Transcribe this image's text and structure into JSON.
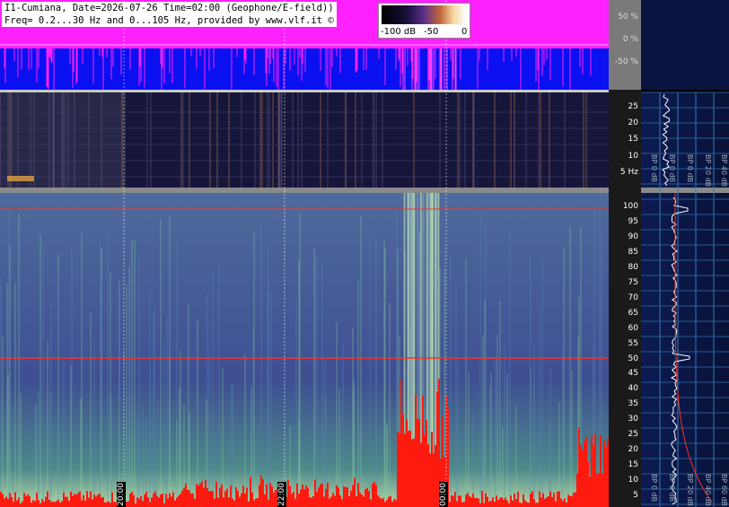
{
  "header": {
    "line1": "I1-Cumiana, Date=2026-07-26 Time=02:00 (Geophone/E-field))",
    "line2": "Freq= 0.2...30 Hz and 0...105 Hz, provided by www.vlf.it ©"
  },
  "legend": {
    "label_min": "-100 dB",
    "label_mid": "-50",
    "label_max": "0"
  },
  "amplitude_axis": {
    "ticks": [
      "50 %",
      "0 %",
      "-50 %"
    ]
  },
  "low_band_axis": {
    "ticks": [
      "25",
      "20",
      "15",
      "10",
      "5 Hz"
    ]
  },
  "high_band_axis": {
    "ticks": [
      "100",
      "95",
      "90",
      "85",
      "80",
      "75",
      "70",
      "65",
      "60",
      "55",
      "50",
      "45",
      "40",
      "35",
      "30",
      "25",
      "20",
      "15",
      "10",
      "5"
    ]
  },
  "time_axis": {
    "labels": [
      "20:00",
      "22:00",
      "00:00"
    ]
  },
  "side_panel": {
    "top_labels": [
      "BP 0 dB",
      "BP 0 dB",
      "BP 0 dB",
      "BP 20 dB",
      "BP 40 dB"
    ],
    "bottom_labels": [
      "BP 0 dB",
      "BP 0 dB",
      "BP 20 dB",
      "BP 40 dB",
      "BP 60 dB"
    ]
  },
  "colors": {
    "amplitude_bg": "#0a10f0",
    "amplitude_signal": "#ff20ff",
    "low_band_bg": "#15163a",
    "high_band_bg": "#3a4a8a",
    "side_bg": "#0a1440",
    "grid": "#3a7ab8",
    "marker_line": "#ff3020"
  }
}
